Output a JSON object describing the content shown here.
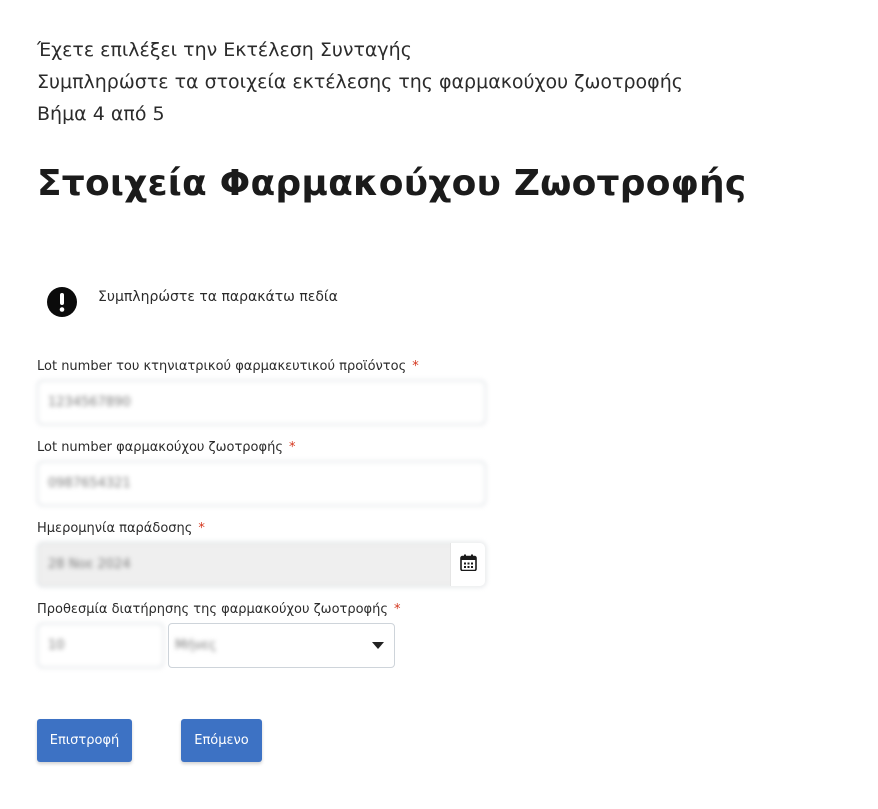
{
  "intro": {
    "line1": "Έχετε επιλέξει την Εκτέλεση Συνταγής",
    "line2": "Συμπληρώστε τα στοιχεία εκτέλεσης της φαρμακούχου ζωοτροφής",
    "line3": "Βήμα 4 από 5"
  },
  "page_title": "Στοιχεία Φαρμακούχου Ζωοτροφής",
  "notice": {
    "icon": "exclamation-circle-icon",
    "text": "Συμπληρώστε τα παρακάτω πεδία"
  },
  "required_marker": "*",
  "fields": {
    "vet_lot": {
      "label": "Lot number του κτηνιατρικού φαρμακευτικού προϊόντος",
      "value": "1234567890"
    },
    "feed_lot": {
      "label": "Lot number φαρμακούχου ζωοτροφής",
      "value": "0987654321"
    },
    "delivery_date": {
      "label": "Ημερομηνία παράδοσης",
      "value": "28 Νοε 2024",
      "icon": "calendar-icon"
    },
    "retention": {
      "label": "Προθεσμία διατήρησης της φαρμακούχου ζωοτροφής",
      "amount": "10",
      "unit": "Μήνες",
      "unit_icon": "caret-down-icon"
    }
  },
  "buttons": {
    "back": "Επιστροφή",
    "next": "Επόμενο"
  },
  "colors": {
    "primary_button": "#3d72c4",
    "required": "#d4351c",
    "disabled_bg": "#efefef"
  }
}
